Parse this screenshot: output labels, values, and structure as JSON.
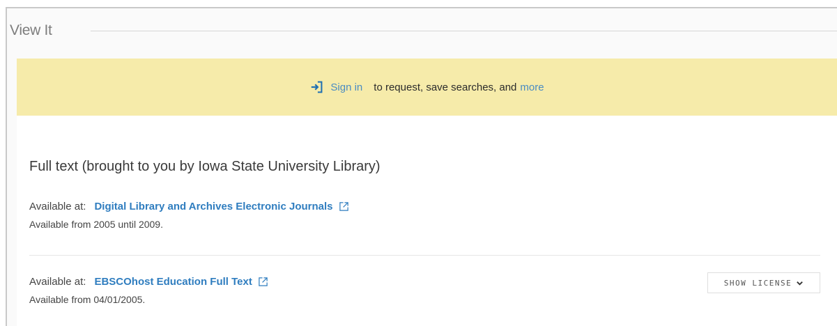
{
  "section": {
    "title": "View It"
  },
  "signin_bar": {
    "signin_label": "Sign in",
    "message": "to request, save searches, and",
    "more_label": "more",
    "icon": "sign-in-icon",
    "background": "#f6ebaa"
  },
  "fulltext": {
    "title": "Full text (brought to you by Iowa State University Library)",
    "services": [
      {
        "available_label": "Available at:",
        "provider": "Digital Library and Archives Electronic Journals",
        "coverage": "Available from 2005 until 2009.",
        "icon": "external-link-icon"
      },
      {
        "available_label": "Available at:",
        "provider": "EBSCOhost Education Full Text",
        "coverage": "Available from 04/01/2005.",
        "icon": "external-link-icon"
      }
    ],
    "license_button": {
      "label": "SHOW LICENSE",
      "icon": "chevron-down-icon"
    }
  },
  "colors": {
    "link": "#2f7dbf",
    "accent": "#4a8cc2"
  }
}
